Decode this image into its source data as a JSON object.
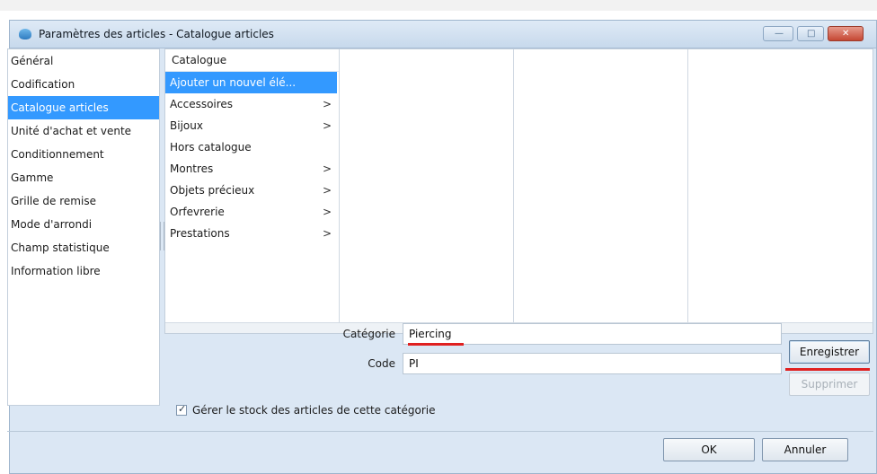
{
  "window": {
    "title": "Paramètres des articles - Catalogue articles",
    "controls": {
      "minimize": "—",
      "maximize": "□",
      "close": "✕"
    }
  },
  "nav": {
    "items": [
      {
        "label": "Général",
        "selected": false
      },
      {
        "label": "Codification",
        "selected": false
      },
      {
        "label": "Catalogue articles",
        "selected": true
      },
      {
        "label": "Unité d'achat et vente",
        "selected": false
      },
      {
        "label": "Conditionnement",
        "selected": false
      },
      {
        "label": "Gamme",
        "selected": false
      },
      {
        "label": "Grille de remise",
        "selected": false
      },
      {
        "label": "Mode d'arrondi",
        "selected": false
      },
      {
        "label": "Champ statistique",
        "selected": false
      },
      {
        "label": "Information libre",
        "selected": false
      }
    ]
  },
  "catalog": {
    "header": "Catalogue",
    "items": [
      {
        "label": "Ajouter un nouvel élé...",
        "selected": true,
        "has_children": false
      },
      {
        "label": "Accessoires",
        "selected": false,
        "has_children": true
      },
      {
        "label": "Bijoux",
        "selected": false,
        "has_children": true
      },
      {
        "label": "Hors catalogue",
        "selected": false,
        "has_children": false
      },
      {
        "label": "Montres",
        "selected": false,
        "has_children": true
      },
      {
        "label": "Objets précieux",
        "selected": false,
        "has_children": true
      },
      {
        "label": "Orfevrerie",
        "selected": false,
        "has_children": true
      },
      {
        "label": "Prestations",
        "selected": false,
        "has_children": true
      }
    ],
    "arrow_glyph": ">"
  },
  "form": {
    "categorie_label": "Catégorie",
    "categorie_value": "Piercing",
    "code_label": "Code",
    "code_value": "PI",
    "save_label": "Enregistrer",
    "delete_label": "Supprimer",
    "stock_checkbox_label": "Gérer le stock des articles de cette catégorie",
    "stock_checked": true,
    "check_glyph": "✓"
  },
  "footer": {
    "ok_label": "OK",
    "cancel_label": "Annuler"
  },
  "colors": {
    "selection": "#3399ff",
    "annotation_underline": "#e02020"
  }
}
